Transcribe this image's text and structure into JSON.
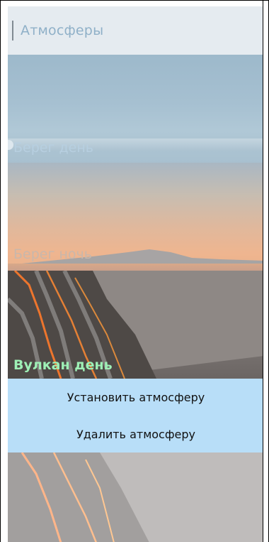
{
  "header": {
    "title": "Атмосферы"
  },
  "atmospheres": [
    {
      "label": "Берег день"
    },
    {
      "label": "Берег ночь"
    },
    {
      "label": "Вулкан день"
    }
  ],
  "actions": {
    "install_label": "Установить атмосферу",
    "delete_label": "Удалить атмосферу"
  },
  "colors": {
    "header_bg": "#e5ebf0",
    "header_text": "#8fb0c8",
    "action_panel_bg": "#b8def8",
    "selected_label": "#9ef0b6"
  }
}
